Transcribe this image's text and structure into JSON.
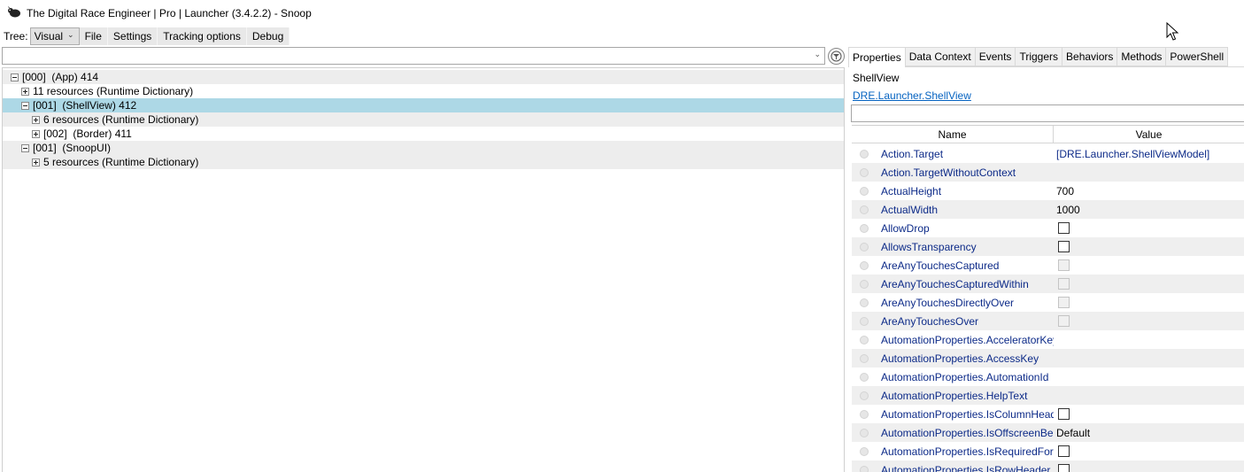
{
  "window": {
    "title": "The Digital Race Engineer | Pro | Launcher (3.4.2.2) - Snoop"
  },
  "toolbar": {
    "tree_label": "Tree:",
    "tree_select_value": "Visual",
    "menus": [
      "File",
      "Settings",
      "Tracking options",
      "Debug"
    ]
  },
  "tree": {
    "rows": [
      {
        "text": "[000]  (App) 414",
        "expander": "minus"
      },
      {
        "text": "11 resources (Runtime Dictionary)",
        "expander": "plus"
      },
      {
        "text": "[001]  (ShellView) 412",
        "expander": "minus"
      },
      {
        "text": "6 resources (Runtime Dictionary)",
        "expander": "plus"
      },
      {
        "text": "[002]  (Border) 411",
        "expander": "plus"
      },
      {
        "text": "[001]  (SnoopUI)",
        "expander": "minus"
      },
      {
        "text": "5 resources (Runtime Dictionary)",
        "expander": "plus"
      }
    ],
    "selected_index": 2
  },
  "tabs": [
    "Properties",
    "Data Context",
    "Events",
    "Triggers",
    "Behaviors",
    "Methods",
    "PowerShell"
  ],
  "active_tab": "Properties",
  "inspector": {
    "target_name": "ShellView",
    "target_type": "DRE.Launcher.ShellView",
    "column_name": "Name",
    "column_value": "Value"
  },
  "properties": [
    {
      "name": "Action.Target",
      "value": "[DRE.Launcher.ShellViewModel]",
      "kind": "link"
    },
    {
      "name": "Action.TargetWithoutContext",
      "value": "",
      "kind": "text"
    },
    {
      "name": "ActualHeight",
      "value": "700",
      "kind": "text"
    },
    {
      "name": "ActualWidth",
      "value": "1000",
      "kind": "text"
    },
    {
      "name": "AllowDrop",
      "value": "",
      "kind": "checkbox"
    },
    {
      "name": "AllowsTransparency",
      "value": "",
      "kind": "checkbox"
    },
    {
      "name": "AreAnyTouchesCaptured",
      "value": "",
      "kind": "checkbox-disabled"
    },
    {
      "name": "AreAnyTouchesCapturedWithin",
      "value": "",
      "kind": "checkbox-disabled"
    },
    {
      "name": "AreAnyTouchesDirectlyOver",
      "value": "",
      "kind": "checkbox-disabled"
    },
    {
      "name": "AreAnyTouchesOver",
      "value": "",
      "kind": "checkbox-disabled"
    },
    {
      "name": "AutomationProperties.AcceleratorKey",
      "value": "",
      "kind": "text"
    },
    {
      "name": "AutomationProperties.AccessKey",
      "value": "",
      "kind": "text"
    },
    {
      "name": "AutomationProperties.AutomationId",
      "value": "",
      "kind": "text"
    },
    {
      "name": "AutomationProperties.HelpText",
      "value": "",
      "kind": "text"
    },
    {
      "name": "AutomationProperties.IsColumnHeader",
      "value": "",
      "kind": "checkbox"
    },
    {
      "name": "AutomationProperties.IsOffscreenBehavior",
      "value": "Default",
      "kind": "text"
    },
    {
      "name": "AutomationProperties.IsRequiredForForm",
      "value": "",
      "kind": "checkbox"
    },
    {
      "name": "AutomationProperties.IsRowHeader",
      "value": "",
      "kind": "checkbox"
    }
  ]
}
